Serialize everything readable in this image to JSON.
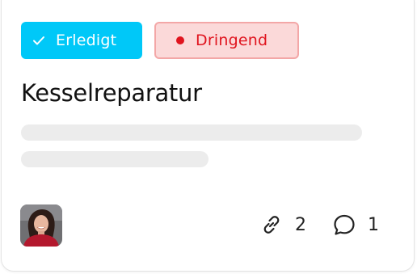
{
  "badges": {
    "done_label": "Erledigt",
    "urgent_label": "Dringend"
  },
  "task": {
    "title": "Kesselreparatur"
  },
  "footer": {
    "links_count": "2",
    "comments_count": "1"
  },
  "colors": {
    "done_bg": "#00c8f8",
    "urgent_bg": "#fbd9d9",
    "urgent_text": "#e0141e"
  },
  "icons": {
    "done": "check-icon",
    "urgent": "dot-icon",
    "links": "link-icon",
    "comments": "comment-icon"
  }
}
